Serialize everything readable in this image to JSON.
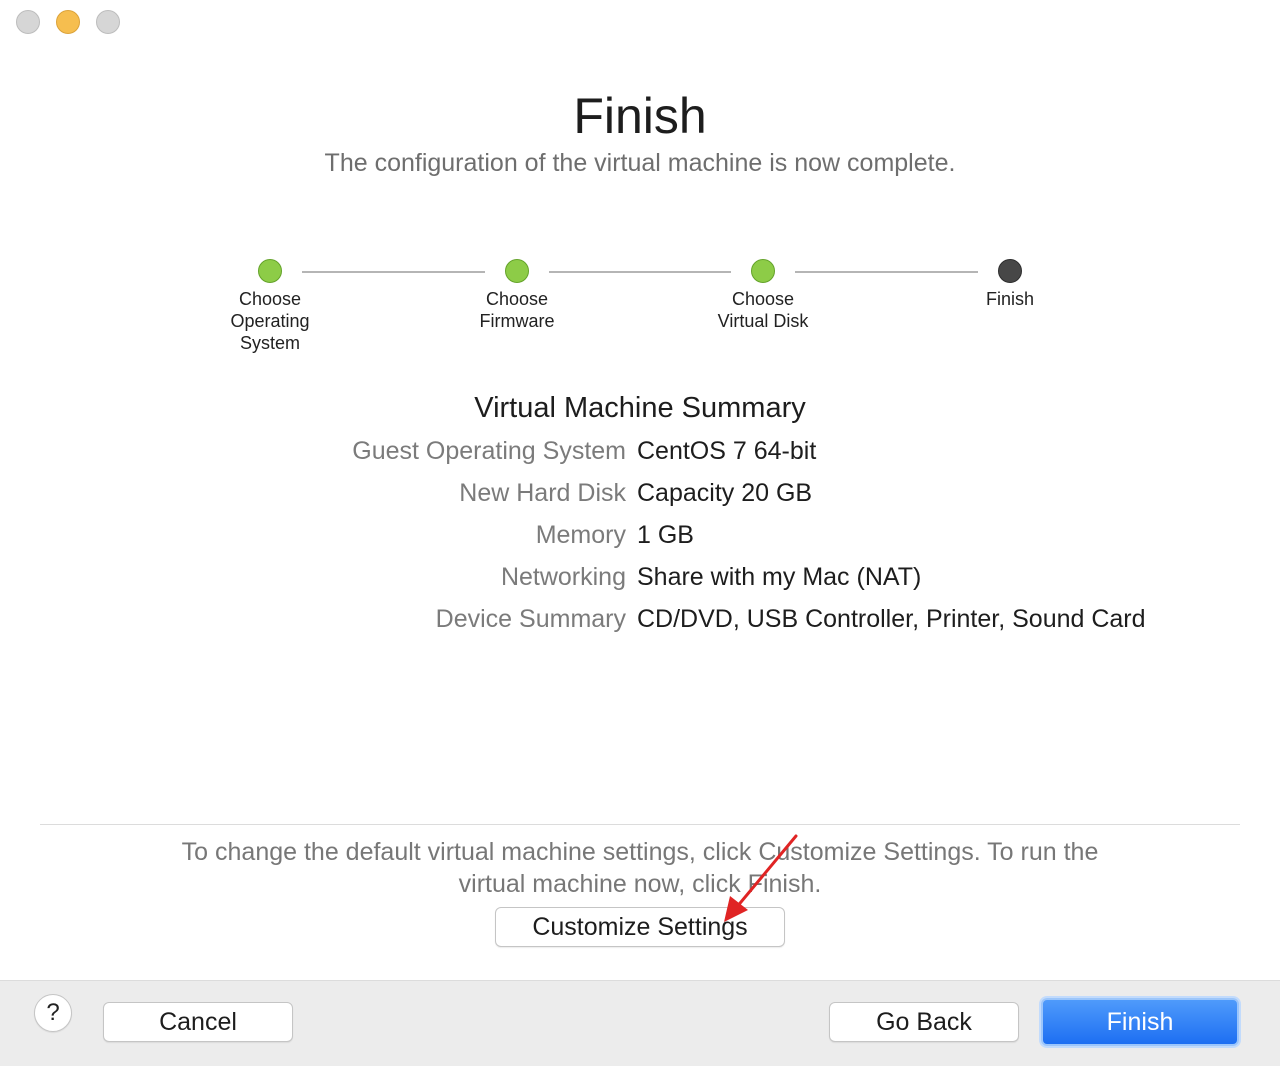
{
  "window": {
    "controls": [
      "close",
      "minimize",
      "maximize"
    ]
  },
  "header": {
    "title": "Finish",
    "subtitle": "The configuration of the virtual machine is now complete."
  },
  "steps": [
    {
      "label": "Choose\nOperating\nSystem",
      "state": "done"
    },
    {
      "label": "Choose\nFirmware",
      "state": "done"
    },
    {
      "label": "Choose\nVirtual Disk",
      "state": "done"
    },
    {
      "label": "Finish",
      "state": "current"
    }
  ],
  "colors": {
    "step_done": "#8dcc47",
    "step_current": "#474747",
    "primary_button": "#1d6ff2",
    "annotation_arrow": "#e02424"
  },
  "summary": {
    "heading": "Virtual Machine Summary",
    "rows": [
      {
        "key": "Guest Operating System",
        "value": "CentOS 7 64-bit"
      },
      {
        "key": "New Hard Disk",
        "value": "Capacity 20 GB"
      },
      {
        "key": "Memory",
        "value": "1 GB"
      },
      {
        "key": "Networking",
        "value": "Share with my Mac (NAT)"
      },
      {
        "key": "Device Summary",
        "value": "CD/DVD, USB Controller, Printer, Sound Card"
      }
    ]
  },
  "hint": {
    "line1": "To change the default virtual machine settings, click Customize Settings. To run the",
    "line2": "virtual machine now, click Finish."
  },
  "buttons": {
    "customize": "Customize Settings",
    "help": "?",
    "cancel": "Cancel",
    "go_back": "Go Back",
    "finish": "Finish"
  }
}
